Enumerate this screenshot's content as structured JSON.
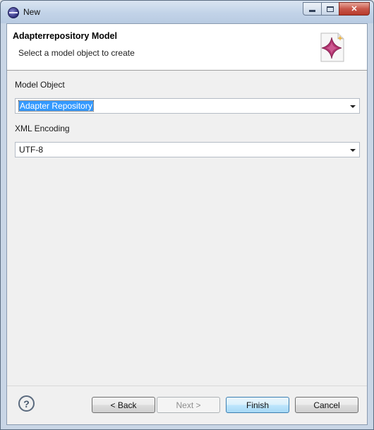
{
  "window": {
    "title": "New"
  },
  "banner": {
    "title": "Adapterrepository Model",
    "subtitle": "Select a model object to create",
    "icon": "wizard-sparkle-icon"
  },
  "form": {
    "model_object_label": "Model Object",
    "model_object_value": "Adapter Repository",
    "xml_encoding_label": "XML Encoding",
    "xml_encoding_value": "UTF-8"
  },
  "buttons": {
    "help_label": "?",
    "back_label": "< Back",
    "next_label": "Next >",
    "finish_label": "Finish",
    "cancel_label": "Cancel"
  },
  "colors": {
    "selection": "#3399ff",
    "default_button": "#a7d9f5",
    "close_button": "#c8574a"
  }
}
